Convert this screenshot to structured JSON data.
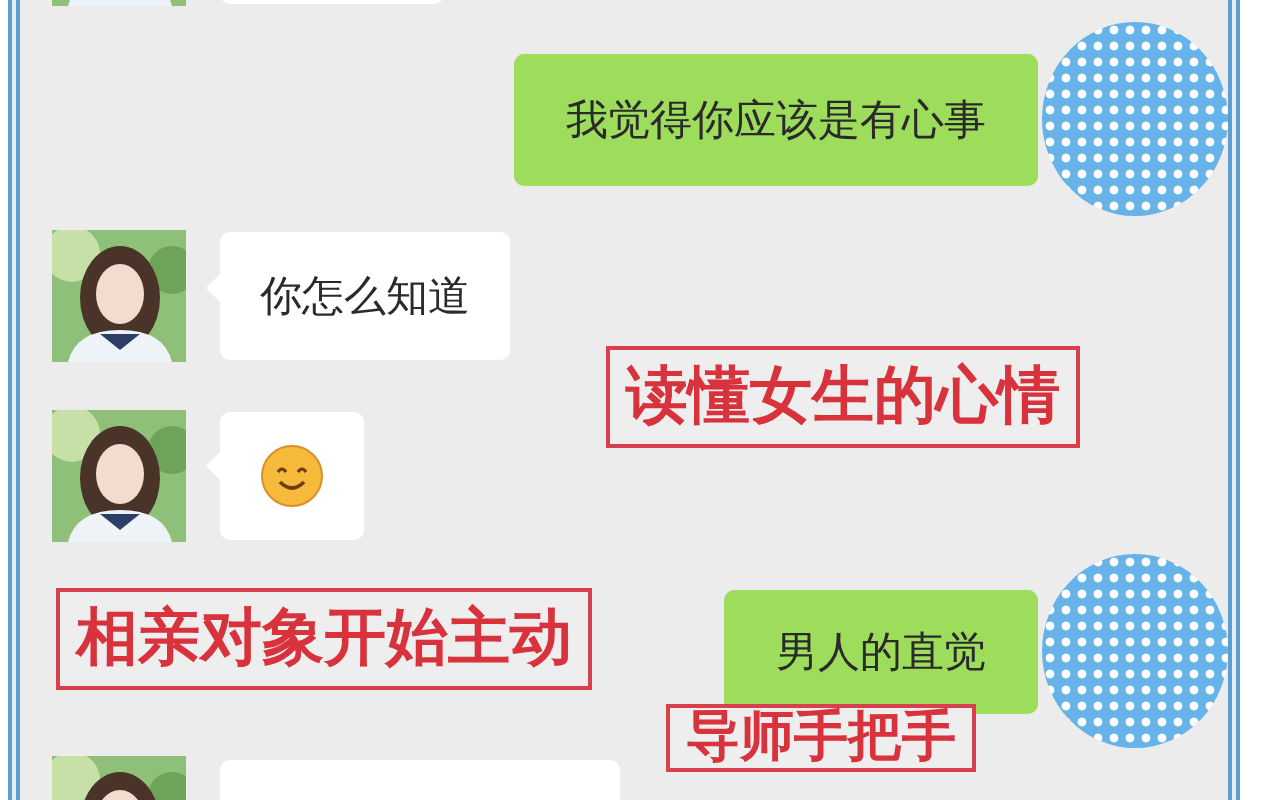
{
  "messages": [
    {
      "outgoing": false,
      "kind": "text"
    },
    {
      "outgoing": true,
      "kind": "text",
      "text": "我觉得你应该是有心事"
    },
    {
      "outgoing": false,
      "kind": "text",
      "text": "你怎么知道"
    },
    {
      "outgoing": false,
      "kind": "emoji"
    },
    {
      "outgoing": true,
      "kind": "text",
      "text": "男人的直觉"
    },
    {
      "outgoing": false,
      "kind": "text"
    }
  ],
  "annotations": [
    {
      "text": "读懂女生的心情"
    },
    {
      "text": "相亲对象开始主动"
    },
    {
      "text": "导师手把手"
    }
  ]
}
